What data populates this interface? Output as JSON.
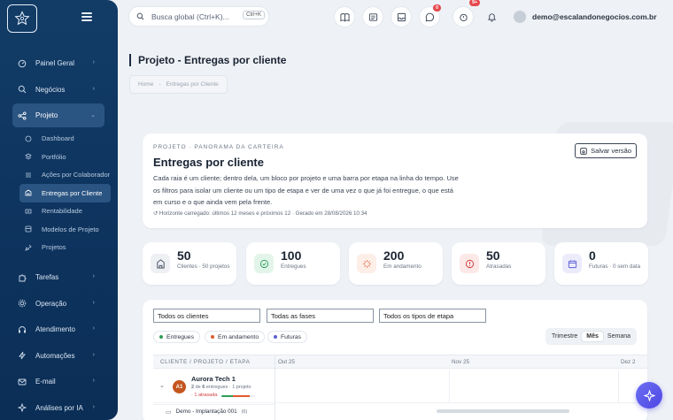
{
  "sidebar": {
    "items": [
      {
        "label": "Painel Geral"
      },
      {
        "label": "Negócios"
      },
      {
        "label": "Projeto"
      },
      {
        "label": "Tarefas"
      },
      {
        "label": "Operação"
      },
      {
        "label": "Atendimento"
      },
      {
        "label": "Automações"
      },
      {
        "label": "E-mail"
      },
      {
        "label": "Análises por IA"
      }
    ],
    "projeto_sub": [
      {
        "label": "Dashboard"
      },
      {
        "label": "Portfólio"
      },
      {
        "label": "Ações por Colaborador"
      },
      {
        "label": "Entregas por Cliente"
      },
      {
        "label": "Rentabilidade"
      },
      {
        "label": "Modelos de Projeto"
      },
      {
        "label": "Projetos"
      }
    ]
  },
  "topbar": {
    "search_placeholder": "Busca global (Ctrl+K)...",
    "search_kbd": "Ctrl+K",
    "whatsapp_badge": "0",
    "notifications_badge": "9+",
    "user_email": "demo@escalandonegocios.com.br"
  },
  "page": {
    "title": "Projeto - Entregas por cliente",
    "breadcrumb": [
      "Home",
      "Entregas por Cliente"
    ]
  },
  "hero": {
    "eyebrow": "PROJETO · PANORAMA DA CARTEIRA",
    "title": "Entregas por cliente",
    "description": "Cada raia é um cliente; dentro dela, um bloco por projeto e uma barra por etapa na linha do tempo. Use os filtros para isolar um cliente ou um tipo de etapa e ver de uma vez o que já foi entregue, o que está em curso e o que ainda vem pela frente.",
    "meta": "Horizonte carregado: últimos 12 meses e próximos 12 · Gerado em 28/08/2026 10:34",
    "save_label": "Salvar versão"
  },
  "stats": [
    {
      "value": "50",
      "label": "Clientes · 50 projetos",
      "color": "#5b6475",
      "bg": "#eef0f4"
    },
    {
      "value": "100",
      "label": "Entregues",
      "color": "#2f9e5b",
      "bg": "#e3f5ea"
    },
    {
      "value": "200",
      "label": "Em andamento",
      "color": "#e05a2b",
      "bg": "#fdeee8"
    },
    {
      "value": "50",
      "label": "Atrasadas",
      "color": "#d13b3b",
      "bg": "#fde8e8"
    },
    {
      "value": "0",
      "label": "Futuras · 0 sem data",
      "color": "#5b5fd6",
      "bg": "#ecebfb"
    }
  ],
  "gantt": {
    "filters": [
      "Todos os clientes",
      "Todas as fases",
      "Todos os tipos de etapa"
    ],
    "legend": [
      {
        "label": "Entregues",
        "color": "#2f9e5b"
      },
      {
        "label": "Em andamento",
        "color": "#e05a2b"
      },
      {
        "label": "Futuras",
        "color": "#5b5fd6"
      }
    ],
    "views": [
      "Trimestre",
      "Mês",
      "Semana"
    ],
    "active_view": "Mês",
    "columns": [
      "CLIENTE / PROJETO / ETAPA",
      "Out 25",
      "Nov 25",
      "Dez 2"
    ],
    "client": {
      "initials": "A1",
      "name": "Aurora Tech 1",
      "done": "2",
      "total": "6",
      "summary_mid": "de",
      "summary_tail": "entregues",
      "projects": "· 1 projeto",
      "late": "· 1 atrasada",
      "progress": {
        "done": 0.33,
        "in_progress": 0.5
      }
    },
    "project_row": {
      "name": "Demo - Implantação 001",
      "count": "(6)"
    }
  }
}
